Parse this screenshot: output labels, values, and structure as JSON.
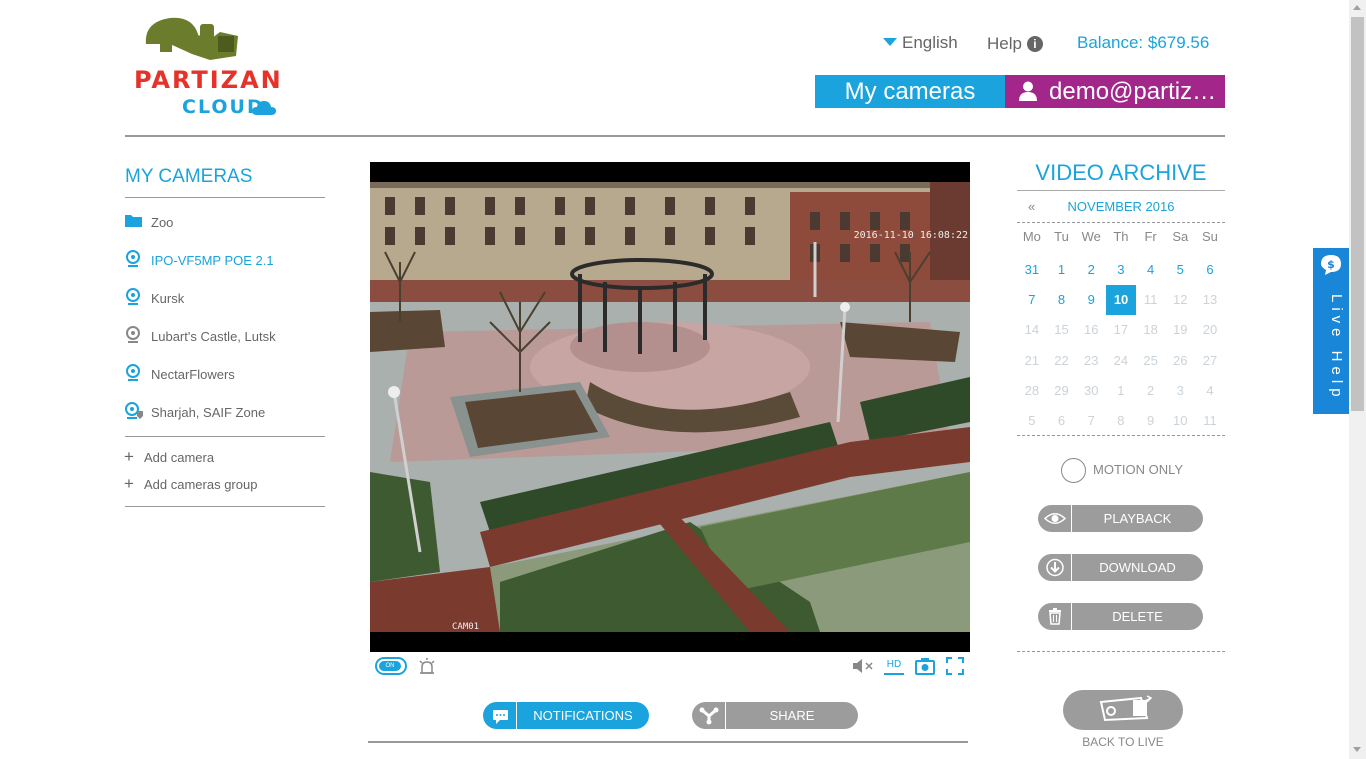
{
  "header": {
    "brand_line1": "PARTIZAN",
    "brand_line2": "CLOUD",
    "language": "English",
    "help": "Help",
    "balance": "Balance: $679.56",
    "my_cameras": "My cameras",
    "user": "demo@partizan.global"
  },
  "sidebar": {
    "title": "MY CAMERAS",
    "items": [
      {
        "label": "Zoo",
        "icon": "folder-icon"
      },
      {
        "label": "IPO-VF5MP POE 2.1",
        "icon": "webcam-icon"
      },
      {
        "label": "Kursk",
        "icon": "webcam-icon"
      },
      {
        "label": "Lubart's Castle, Lutsk",
        "icon": "webcam-icon"
      },
      {
        "label": "NectarFlowers",
        "icon": "webcam-icon"
      },
      {
        "label": "Sharjah, SAIF Zone",
        "icon": "webcam-shared-icon"
      }
    ],
    "add_camera": "Add camera",
    "add_group": "Add cameras group"
  },
  "video": {
    "timestamp": "2016-11-10 16:08:22",
    "camera_label": "CAM01",
    "toggle_label": "ON",
    "hd_label": "HD"
  },
  "actions": {
    "notifications": "NOTIFICATIONS",
    "share": "SHARE"
  },
  "archive": {
    "title": "VIDEO ARCHIVE",
    "prev": "«",
    "month": "NOVEMBER 2016",
    "weekdays": [
      "Mo",
      "Tu",
      "We",
      "Th",
      "Fr",
      "Sa",
      "Su"
    ],
    "weeks": [
      [
        "31",
        "1",
        "2",
        "3",
        "4",
        "5",
        "6"
      ],
      [
        "7",
        "8",
        "9",
        "10",
        "11",
        "12",
        "13"
      ],
      [
        "14",
        "15",
        "16",
        "17",
        "18",
        "19",
        "20"
      ],
      [
        "21",
        "22",
        "23",
        "24",
        "25",
        "26",
        "27"
      ],
      [
        "28",
        "29",
        "30",
        "1",
        "2",
        "3",
        "4"
      ],
      [
        "5",
        "6",
        "7",
        "8",
        "9",
        "10",
        "11"
      ]
    ],
    "selected": "10",
    "motion_only": "MOTION ONLY",
    "playback": "PLAYBACK",
    "download": "DOWNLOAD",
    "delete": "DELETE",
    "back_to_live": "BACK TO LIVE"
  },
  "live_help": "Live Help",
  "colors": {
    "accent": "#1aa3dc",
    "user": "#a3268a",
    "button_gray": "#9c9c9c",
    "live_help": "#1a86d8"
  }
}
